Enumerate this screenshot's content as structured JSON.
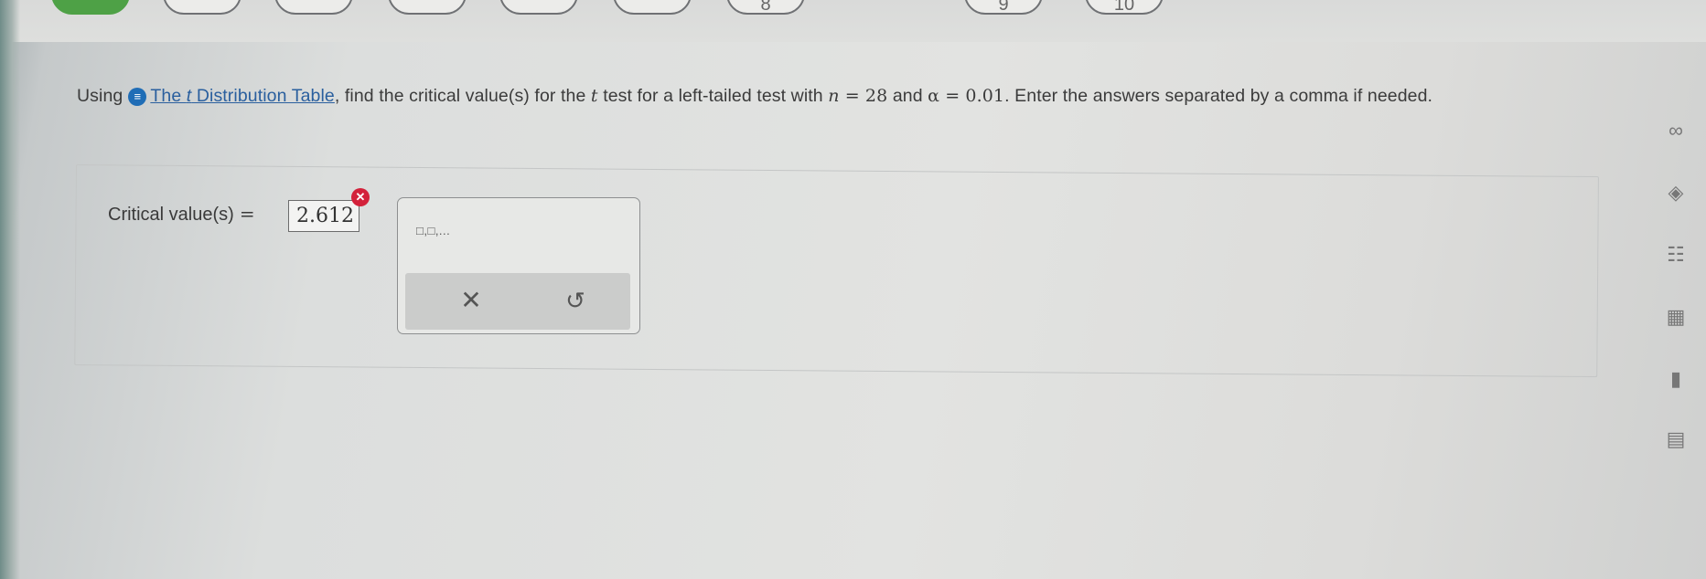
{
  "progress_steps": [
    {
      "label": "",
      "state": "done"
    },
    {
      "label": "",
      "state": "pending"
    },
    {
      "label": "",
      "state": "pending"
    },
    {
      "label": "",
      "state": "pending"
    },
    {
      "label": "",
      "state": "pending"
    },
    {
      "label": "",
      "state": "pending"
    },
    {
      "label": "8",
      "state": "pending"
    },
    {
      "label": "9",
      "state": "pending"
    },
    {
      "label": "10",
      "state": "pending"
    }
  ],
  "question": {
    "prefix": "Using",
    "help_icon": "info-circle-icon",
    "link_text_before": "The ",
    "link_var": "t",
    "link_text_after": " Distribution Table",
    "text_1": ", find the critical value(s) for the ",
    "var_t": "t",
    "text_2": " test for a left-tailed test with ",
    "var_n": "n",
    "eq_n": " = 28",
    "text_3": " and ",
    "var_alpha": "α",
    "eq_alpha": " = 0.01",
    "text_4": ". Enter the answers separated by a comma if needed."
  },
  "answer": {
    "label": "Critical value(s)",
    "equals": "=",
    "value": "2.612",
    "error_icon": "x-circle-icon",
    "error_glyph": "✕"
  },
  "palette": {
    "template_label": "□,□,...",
    "clear_icon": "x-icon",
    "clear_glyph": "✕",
    "undo_icon": "undo-icon",
    "undo_glyph": "↺"
  },
  "sidebar": [
    {
      "name": "infinity-icon",
      "glyph": "∞"
    },
    {
      "name": "tag-icon",
      "glyph": "◈"
    },
    {
      "name": "notes-icon",
      "glyph": "☷"
    },
    {
      "name": "calculator-icon",
      "glyph": "▦"
    },
    {
      "name": "bar-chart-icon",
      "glyph": "▮"
    },
    {
      "name": "formula-sheet-icon",
      "glyph": "▤"
    }
  ]
}
